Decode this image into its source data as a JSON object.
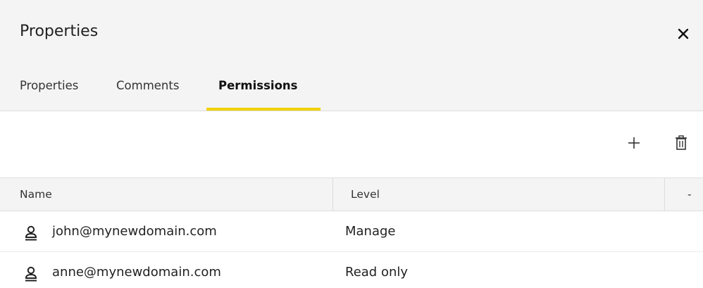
{
  "panel": {
    "title": "Properties",
    "close_icon": "close-icon"
  },
  "tabs": [
    {
      "label": "Properties",
      "active": false
    },
    {
      "label": "Comments",
      "active": false
    },
    {
      "label": "Permissions",
      "active": true
    }
  ],
  "toolbar": {
    "add_icon": "plus-icon",
    "delete_icon": "trash-icon"
  },
  "table": {
    "columns": [
      "Name",
      "Level",
      "-"
    ],
    "rows": [
      {
        "icon": "user-icon",
        "name": "john@mynewdomain.com",
        "level": "Manage"
      },
      {
        "icon": "user-icon",
        "name": "anne@mynewdomain.com",
        "level": "Read only"
      }
    ]
  },
  "colors": {
    "accent": "#f2d100",
    "header_bg": "#f4f4f4"
  }
}
